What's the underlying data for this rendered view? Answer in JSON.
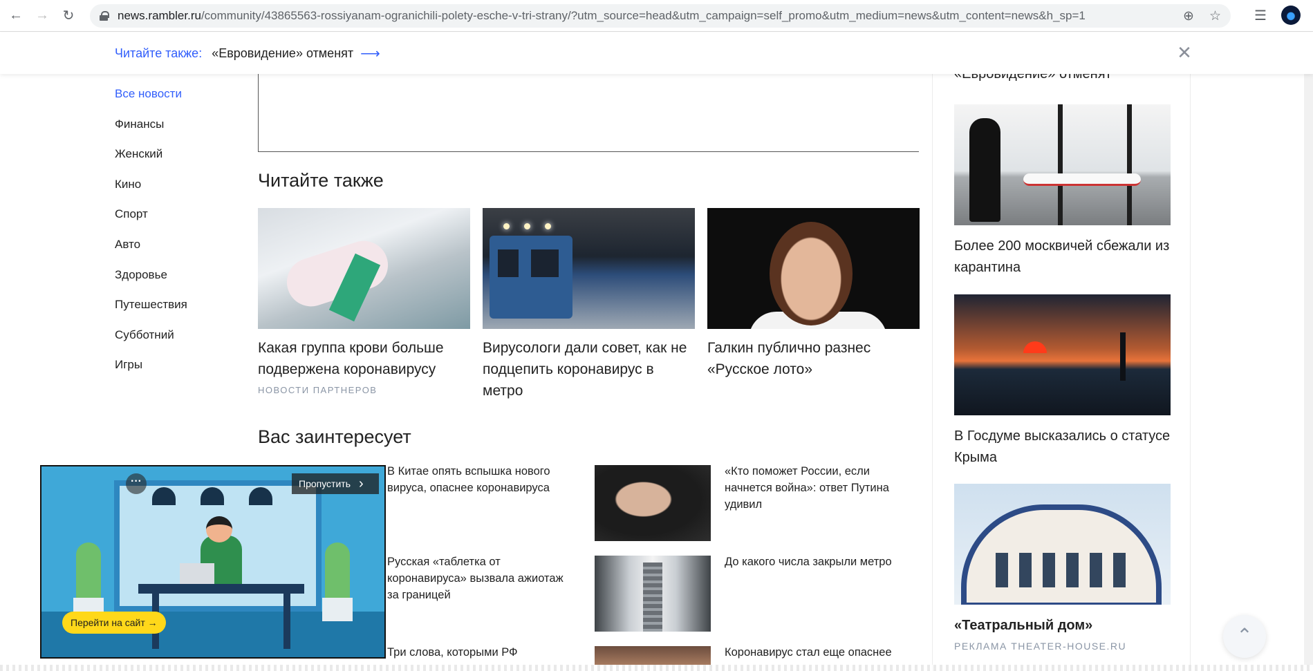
{
  "browser": {
    "url_host": "news.rambler.ru",
    "url_path": "/community/43865563-rossiyanam-ogranichili-polety-esche-v-tri-strany/?utm_source=head&utm_campaign=self_promo&utm_medium=news&utm_content=news&h_sp=1"
  },
  "sticky": {
    "label": "Читайте также:",
    "title": "«Евровидение» отменят",
    "arrow": "⟶",
    "close": "✕"
  },
  "leftnav": {
    "items": [
      "Все новости",
      "Финансы",
      "Женский",
      "Кино",
      "Спорт",
      "Авто",
      "Здоровье",
      "Путешествия",
      "Субботний",
      "Игры"
    ]
  },
  "read_also": {
    "title": "Читайте также",
    "cards": [
      {
        "title": "Какая группа крови больше подвержена коронавирусу",
        "source": "Новости партнеров"
      },
      {
        "title": "Вирусологи дали совет, как не подцепить коронавирус в метро",
        "source": ""
      },
      {
        "title": "Галкин публично разнес «Русское лото»",
        "source": ""
      }
    ]
  },
  "interesting": {
    "title": "Вас заинтересует",
    "items": [
      {
        "title": "В Китае опять вспышка нового вируса, опаснее коронавируса"
      },
      {
        "title": "«Кто поможет России, если начнется война»: ответ Путина удивил"
      },
      {
        "title": "Русская «таблетка от коронавируса» вызвала ажиотаж за границей"
      },
      {
        "title": "До какого числа закрыли метро"
      },
      {
        "title": "Три слова, которыми РФ"
      },
      {
        "title": "Коронавирус стал еще опаснее"
      }
    ]
  },
  "rightcol": {
    "top_title": "«Евровидение» отменят",
    "cards": [
      {
        "title": "Более 200 москвичей сбежали из карантина",
        "source": ""
      },
      {
        "title": "В Госдуме высказались о статусе Крыма",
        "source": ""
      },
      {
        "title": "«Театральный дом»",
        "source": "РЕКЛАМА THEATER-HOUSE.RU"
      }
    ]
  },
  "video_ad": {
    "skip": "Пропустить",
    "goto": "Перейти на сайт →",
    "menu": "···"
  },
  "scroll_up": "⌃"
}
